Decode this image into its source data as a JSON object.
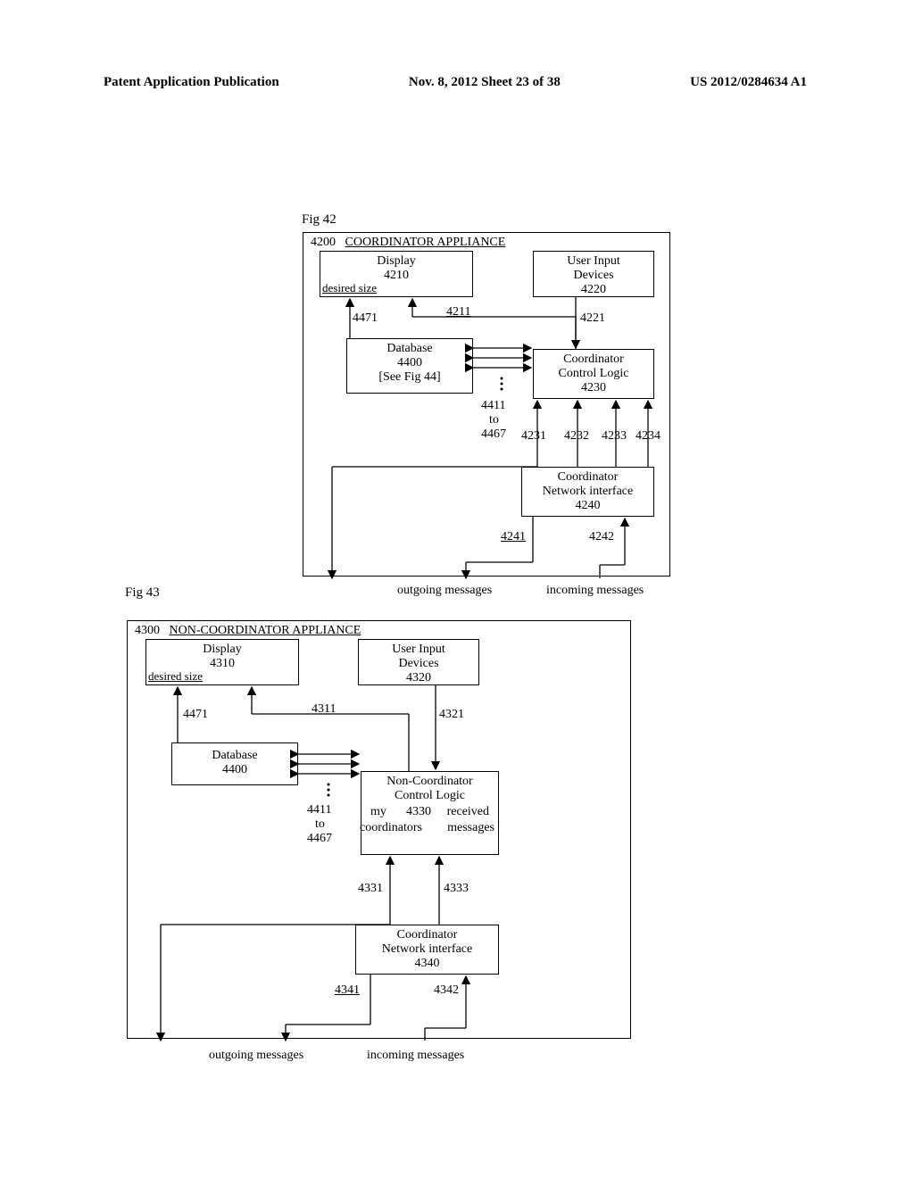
{
  "header": {
    "left": "Patent Application Publication",
    "mid": "Nov. 8, 2012  Sheet 23 of 38",
    "right": "US 2012/0284634 A1"
  },
  "fig42": {
    "label": "Fig 42",
    "container_ref": "4200",
    "container_title": "COORDINATOR APPLIANCE",
    "display": {
      "title": "Display",
      "ref": "4210",
      "note": "desired size"
    },
    "user_input": {
      "title": "User Input",
      "subtitle": "Devices",
      "ref": "4220"
    },
    "database": {
      "title": "Database",
      "ref": "4400",
      "note": "[See Fig 44]"
    },
    "ctrl": {
      "title": "Coordinator",
      "subtitle": "Control Logic",
      "ref": "4230"
    },
    "net": {
      "title": "Coordinator",
      "subtitle": "Network interface",
      "ref": "4240"
    },
    "arrows": {
      "a4471": "4471",
      "a4211": "4211",
      "a4221": "4221",
      "a4411": "4411",
      "a_to": "to",
      "a4467": "4467",
      "a4231": "4231",
      "a4232": "4232",
      "a4233": "4233",
      "a4234": "4234",
      "a4241": "4241",
      "a4242": "4242"
    },
    "msg_out": "outgoing messages",
    "msg_in": "incoming messages"
  },
  "fig43": {
    "label": "Fig 43",
    "container_ref": "4300",
    "container_title": "NON-COORDINATOR APPLIANCE",
    "display": {
      "title": "Display",
      "ref": "4310",
      "note": "desired size"
    },
    "user_input": {
      "title": "User Input",
      "subtitle": "Devices",
      "ref": "4320"
    },
    "database": {
      "title": "Database",
      "ref": "4400"
    },
    "ctrl": {
      "title": "Non-Coordinator",
      "subtitle": "Control Logic",
      "ref": "4330",
      "note_left": "my",
      "note_left2": "coordinators",
      "note_right": "received",
      "note_right2": "messages"
    },
    "net": {
      "title": "Coordinator",
      "subtitle": "Network interface",
      "ref": "4340"
    },
    "arrows": {
      "a4471": "4471",
      "a4311": "4311",
      "a4321": "4321",
      "a4411": "4411",
      "a_to": "to",
      "a4467": "4467",
      "a4331": "4331",
      "a4333": "4333",
      "a4341": "4341",
      "a4342": "4342"
    },
    "msg_out": "outgoing messages",
    "msg_in": "incoming messages"
  }
}
